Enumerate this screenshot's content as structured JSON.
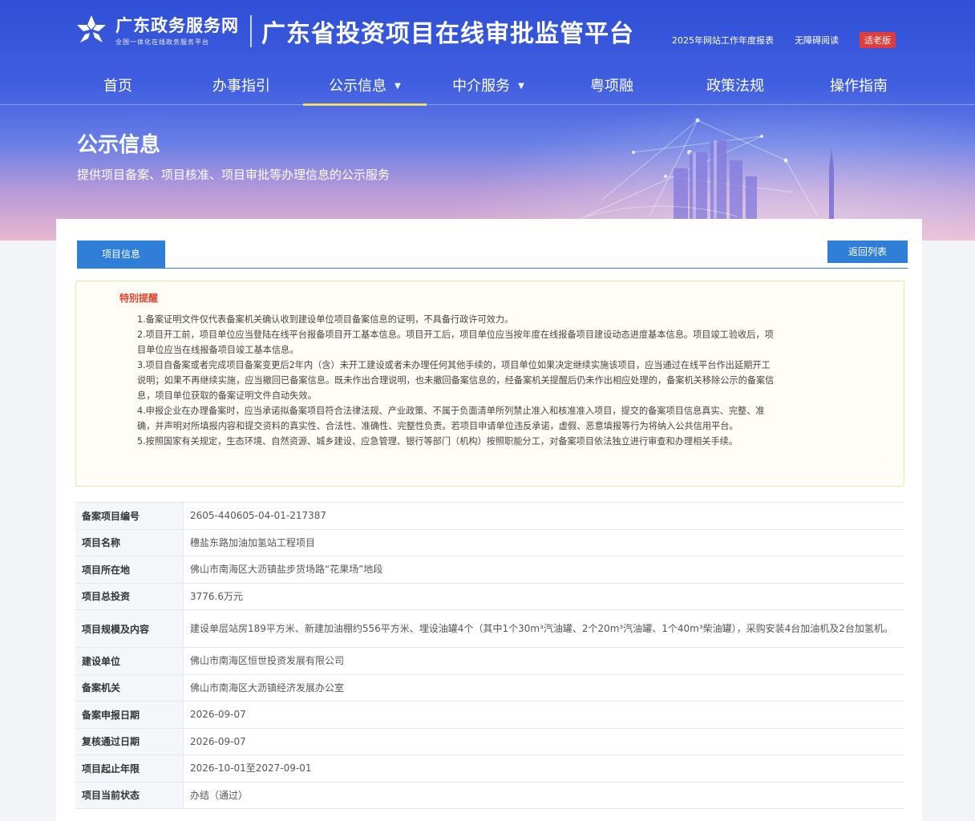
{
  "header": {
    "site_name": "广东政务服务网",
    "site_slogan": "全国一体化在线政务服务平台",
    "platform_title": "广东省投资项目在线审批监管平台",
    "top_links": {
      "annual_report": "2025年网站工作年度报表",
      "accessibility": "无障碍阅读",
      "elder_mode": "适老版"
    }
  },
  "nav": {
    "items": [
      {
        "label": "首页"
      },
      {
        "label": "办事指引"
      },
      {
        "label": "公示信息"
      },
      {
        "label": "中介服务"
      },
      {
        "label": "粤项融"
      },
      {
        "label": "政策法规"
      },
      {
        "label": "操作指南"
      }
    ],
    "active": "公示信息",
    "dropdown_items": [
      "公示信息",
      "中介服务"
    ]
  },
  "page": {
    "heading": "公示信息",
    "subheading": "提供项目备案、项目核准、项目审批等办理信息的公示服务"
  },
  "card": {
    "tab_label": "项目信息",
    "back_button": "返回列表"
  },
  "notice": {
    "title": "特别提醒",
    "items": [
      "1.备案证明文件仅代表备案机关确认收到建设单位项目备案信息的证明，不具备行政许可效力。",
      "2.项目开工前，项目单位应当登陆在线平台报备项目开工基本信息。项目开工后，项目单位应当按年度在线报备项目建设动态进度基本信息。项目竣工验收后，项目单位应当在线报备项目竣工基本信息。",
      "3.项目自备案或者完成项目备案变更后2年内（含）未开工建设或者未办理任何其他手续的，项目单位如果决定继续实施该项目，应当通过在线平台作出延期开工说明；如果不再继续实施，应当撤回已备案信息。既未作出合理说明，也未撤回备案信息的，经备案机关提醒后仍未作出相应处理的，备案机关移除公示的备案信息，项目单位获取的备案证明文件自动失效。",
      "4.申报企业在办理备案时，应当承诺拟备案项目符合法律法规、产业政策、不属于负面清单所列禁止准入和核准准入项目，提交的备案项目信息真实、完整、准确，并声明对所填报内容和提交资料的真实性、合法性、准确性、完整性负责。若项目申请单位违反承诺，虚假、恶意填报等行为将纳入公共信用平台。",
      "5.按照国家有关规定，生态环境、自然资源、城乡建设、应急管理、银行等部门（机构）按照职能分工，对备案项目依法独立进行审查和办理相关手续。"
    ]
  },
  "project_table": {
    "rows": [
      {
        "label": "备案项目编号",
        "value": "2605-440605-04-01-217387"
      },
      {
        "label": "项目名称",
        "value": "穗盐东路加油加氢站工程项目"
      },
      {
        "label": "项目所在地",
        "value": "佛山市南海区大沥镇盐步货场路“花果场”地段"
      },
      {
        "label": "项目总投资",
        "value": "3776.6万元"
      },
      {
        "label": "项目规模及内容",
        "value": "建设单层站房189平方米、新建加油棚约556平方米、埋设油罐4个（其中1个30m³汽油罐、2个20m³汽油罐、1个40m³柴油罐），采购安装4台加油机及2台加氢机。"
      },
      {
        "label": "建设单位",
        "value": "佛山市南海区恒世投资发展有限公司"
      },
      {
        "label": "备案机关",
        "value": "佛山市南海区大沥镇经济发展办公室"
      },
      {
        "label": "备案申报日期",
        "value": "2026-09-07"
      },
      {
        "label": "复核通过日期",
        "value": "2026-09-07"
      },
      {
        "label": "项目起止年限",
        "value": "2026-10-01至2027-09-01"
      },
      {
        "label": "项目当前状态",
        "value": "办结（通过）"
      }
    ]
  },
  "colors": {
    "banner_blue": "#2f4fd6",
    "primary_button": "#2f7fd8",
    "notice_title": "#e0432f",
    "nav_active_underline": "#f5d24b",
    "elder_badge": "#e23b3b"
  }
}
